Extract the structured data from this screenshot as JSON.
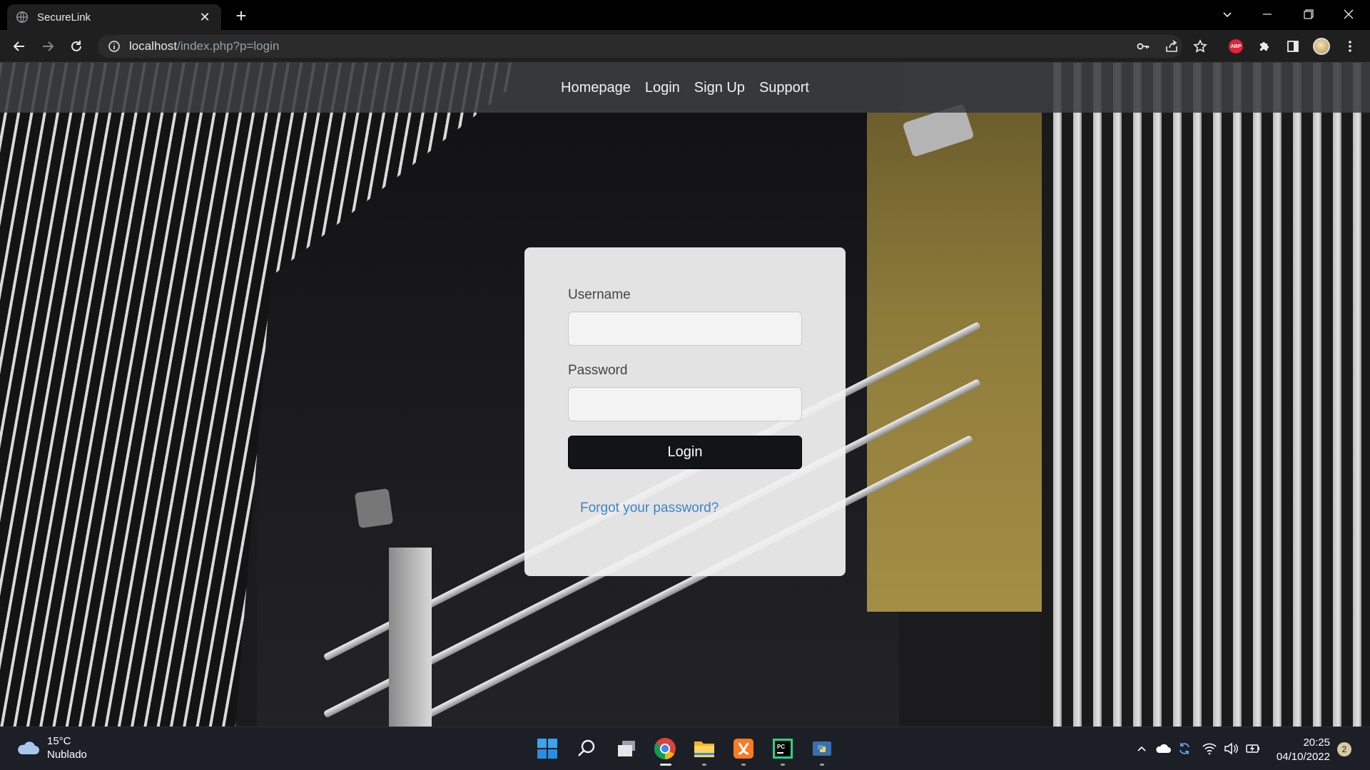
{
  "browser": {
    "tab_title": "SecureLink",
    "url_host": "localhost",
    "url_path": "/index.php?p=login",
    "abp_label": "ABP"
  },
  "nav": {
    "items": [
      {
        "label": "Homepage"
      },
      {
        "label": "Login"
      },
      {
        "label": "Sign Up"
      },
      {
        "label": "Support"
      }
    ]
  },
  "login": {
    "username_label": "Username",
    "username_value": "",
    "password_label": "Password",
    "password_value": "",
    "login_button": "Login",
    "forgot_link": "Forgot your password?"
  },
  "taskbar": {
    "weather_temp": "15°C",
    "weather_desc": "Nublado",
    "time": "20:25",
    "date": "04/10/2022",
    "notification_count": "2"
  }
}
